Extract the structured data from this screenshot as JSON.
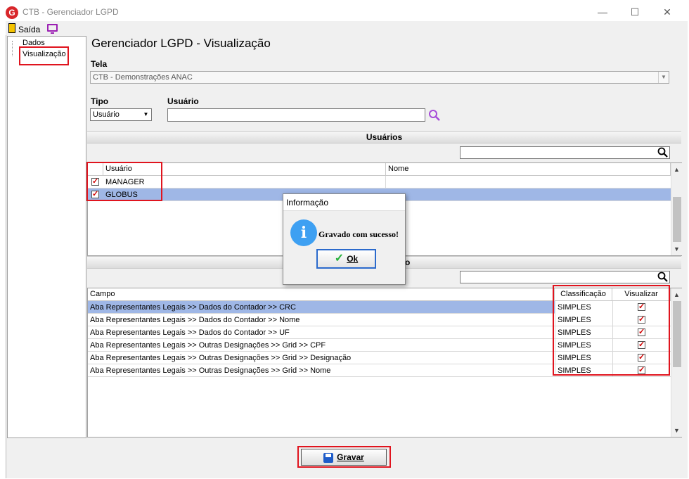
{
  "window": {
    "title": "CTB - Gerenciador LGPD",
    "minimize": "—",
    "maximize": "☐",
    "close": "✕"
  },
  "menu": {
    "exit_label": "Saída"
  },
  "tree": {
    "items": [
      "Dados",
      "Visualização"
    ]
  },
  "page": {
    "title": "Gerenciador LGPD - Visualização"
  },
  "tela": {
    "label": "Tela",
    "value": "CTB - Demonstrações ANAC"
  },
  "tipo": {
    "label": "Tipo",
    "value": "Usuário"
  },
  "usuario": {
    "label": "Usuário",
    "value": ""
  },
  "users_section": {
    "title": "Usuários",
    "columns": [
      "Usuário",
      "Nome"
    ],
    "rows": [
      {
        "usuario": "MANAGER",
        "nome": "",
        "checked": true,
        "selected": false
      },
      {
        "usuario": "GLOBUS",
        "nome": "",
        "checked": true,
        "selected": true
      }
    ]
  },
  "fields_section": {
    "title_tail": "o",
    "columns": [
      "Campo",
      "Classificação",
      "Visualizar"
    ],
    "rows": [
      {
        "campo": "Aba Representantes Legais  >> Dados do Contador  >>  CRC",
        "classificacao": "SIMPLES",
        "visualizar": true,
        "selected": true
      },
      {
        "campo": "Aba Representantes Legais  >> Dados do Contador  >>  Nome",
        "classificacao": "SIMPLES",
        "visualizar": true,
        "selected": false
      },
      {
        "campo": "Aba Representantes Legais  >> Dados do Contador  >> UF",
        "classificacao": "SIMPLES",
        "visualizar": true,
        "selected": false
      },
      {
        "campo": "Aba Representantes Legais  >> Outras Designações >> Grid >> CPF",
        "classificacao": "SIMPLES",
        "visualizar": true,
        "selected": false
      },
      {
        "campo": "Aba Representantes Legais  >> Outras Designações >> Grid >> Designação",
        "classificacao": "SIMPLES",
        "visualizar": true,
        "selected": false
      },
      {
        "campo": "Aba Representantes Legais  >> Outras Designações >> Grid >> Nome",
        "classificacao": "SIMPLES",
        "visualizar": true,
        "selected": false
      }
    ]
  },
  "dialog": {
    "title": "Informação",
    "message": "Gravado com sucesso!",
    "ok_label": "Ok"
  },
  "save_button": {
    "label": "Gravar"
  },
  "colors": {
    "accent_red": "#e0141e",
    "selection": "#9fb7e6",
    "info_blue": "#3ea0f2"
  }
}
